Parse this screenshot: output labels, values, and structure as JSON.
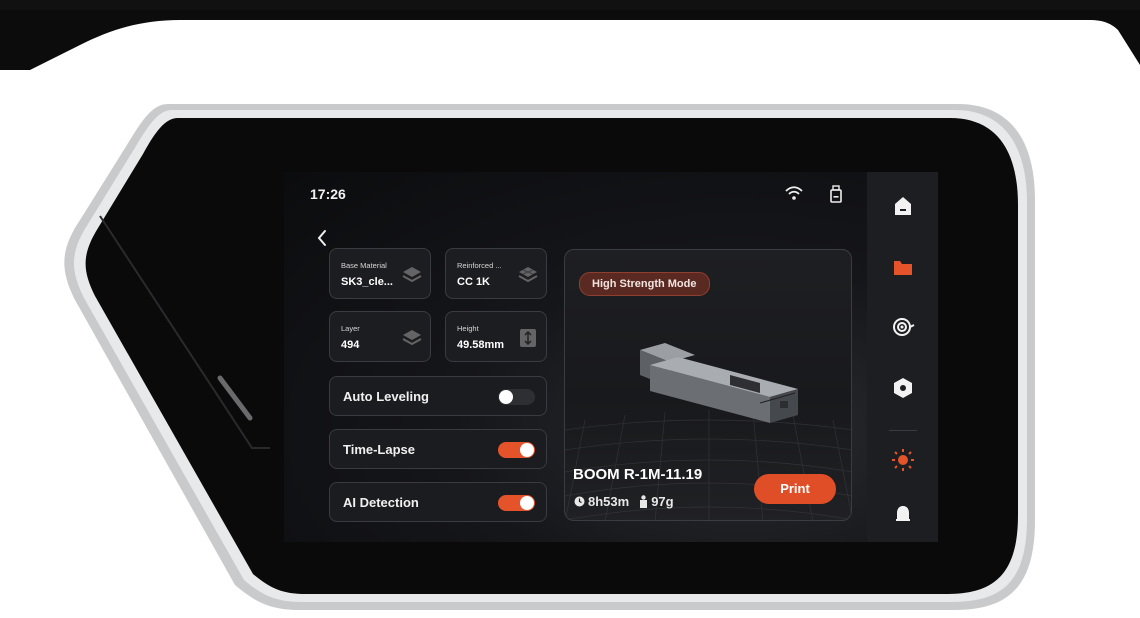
{
  "status": {
    "time": "17:26"
  },
  "icons": {
    "wifi": "wifi-icon",
    "usb": "usb-drive-icon",
    "back": "chevron-left-icon"
  },
  "cards": [
    {
      "label": "Base Material",
      "value": "SK3_cle..."
    },
    {
      "label": "Reinforced ...",
      "value": "CC 1K"
    },
    {
      "label": "Layer",
      "value": "494"
    },
    {
      "label": "Height",
      "value": "49.58mm"
    }
  ],
  "settings": [
    {
      "label": "Auto Leveling",
      "enabled": false
    },
    {
      "label": "Time-Lapse",
      "enabled": true
    },
    {
      "label": "AI Detection",
      "enabled": true
    }
  ],
  "preview": {
    "mode_badge": "High Strength Mode",
    "file_name": "BOOM R-1M-11.19",
    "duration": "8h53m",
    "weight": "97g",
    "print_label": "Print"
  },
  "sidebar": [
    {
      "icon": "home-icon",
      "active": false
    },
    {
      "icon": "folder-icon",
      "active": true
    },
    {
      "icon": "filament-spool-icon",
      "active": false
    },
    {
      "icon": "hexagon-nozzle-icon",
      "active": false
    },
    {
      "icon": "light-icon",
      "active": true
    },
    {
      "icon": "bell-icon",
      "active": false
    }
  ],
  "colors": {
    "accent": "#e5532b",
    "screen_bg": "#0d0e10",
    "sidebar_bg": "#1d1e21",
    "card_bg": "#1c1d20"
  }
}
